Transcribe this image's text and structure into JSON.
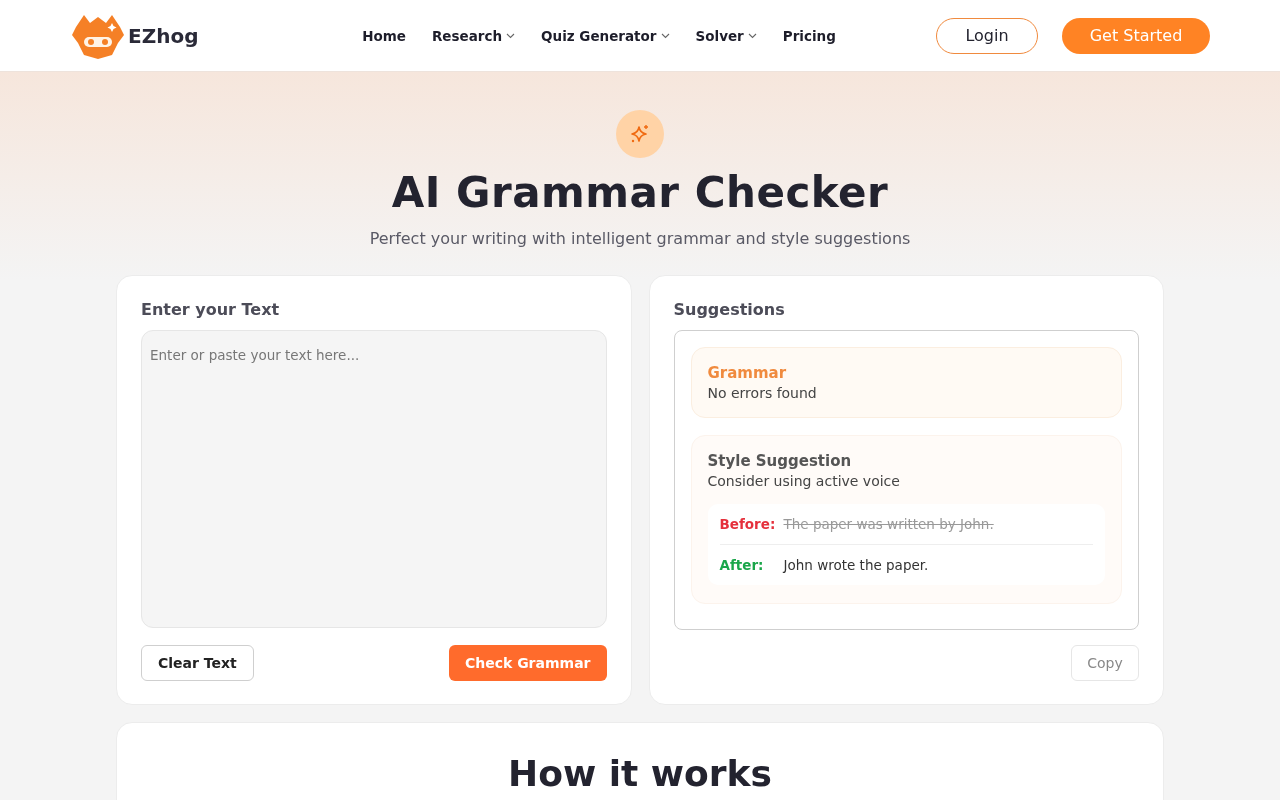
{
  "header": {
    "brand": "EZhog",
    "nav": [
      {
        "label": "Home",
        "dropdown": false
      },
      {
        "label": "Research",
        "dropdown": true
      },
      {
        "label": "Quiz Generator",
        "dropdown": true
      },
      {
        "label": "Solver",
        "dropdown": true
      },
      {
        "label": "Pricing",
        "dropdown": false
      }
    ],
    "login": "Login",
    "cta": "Get Started"
  },
  "hero": {
    "title": "AI Grammar Checker",
    "subtitle": "Perfect your writing with intelligent grammar and style suggestions"
  },
  "input_panel": {
    "title": "Enter your Text",
    "placeholder": "Enter or paste your text here...",
    "clear_button": "Clear Text",
    "check_button": "Check Grammar"
  },
  "suggestions_panel": {
    "title": "Suggestions",
    "items": [
      {
        "kind": "grammar",
        "title": "Grammar",
        "text": "No errors found"
      },
      {
        "kind": "style",
        "title": "Style Suggestion",
        "text": "Consider using active voice",
        "before_label": "Before:",
        "before": "The paper was written by John.",
        "after_label": "After:",
        "after": "John wrote the paper."
      }
    ],
    "copy_button": {
      "label": "Copy",
      "disabled": true
    }
  },
  "how_it_works": {
    "title": "How it works"
  }
}
